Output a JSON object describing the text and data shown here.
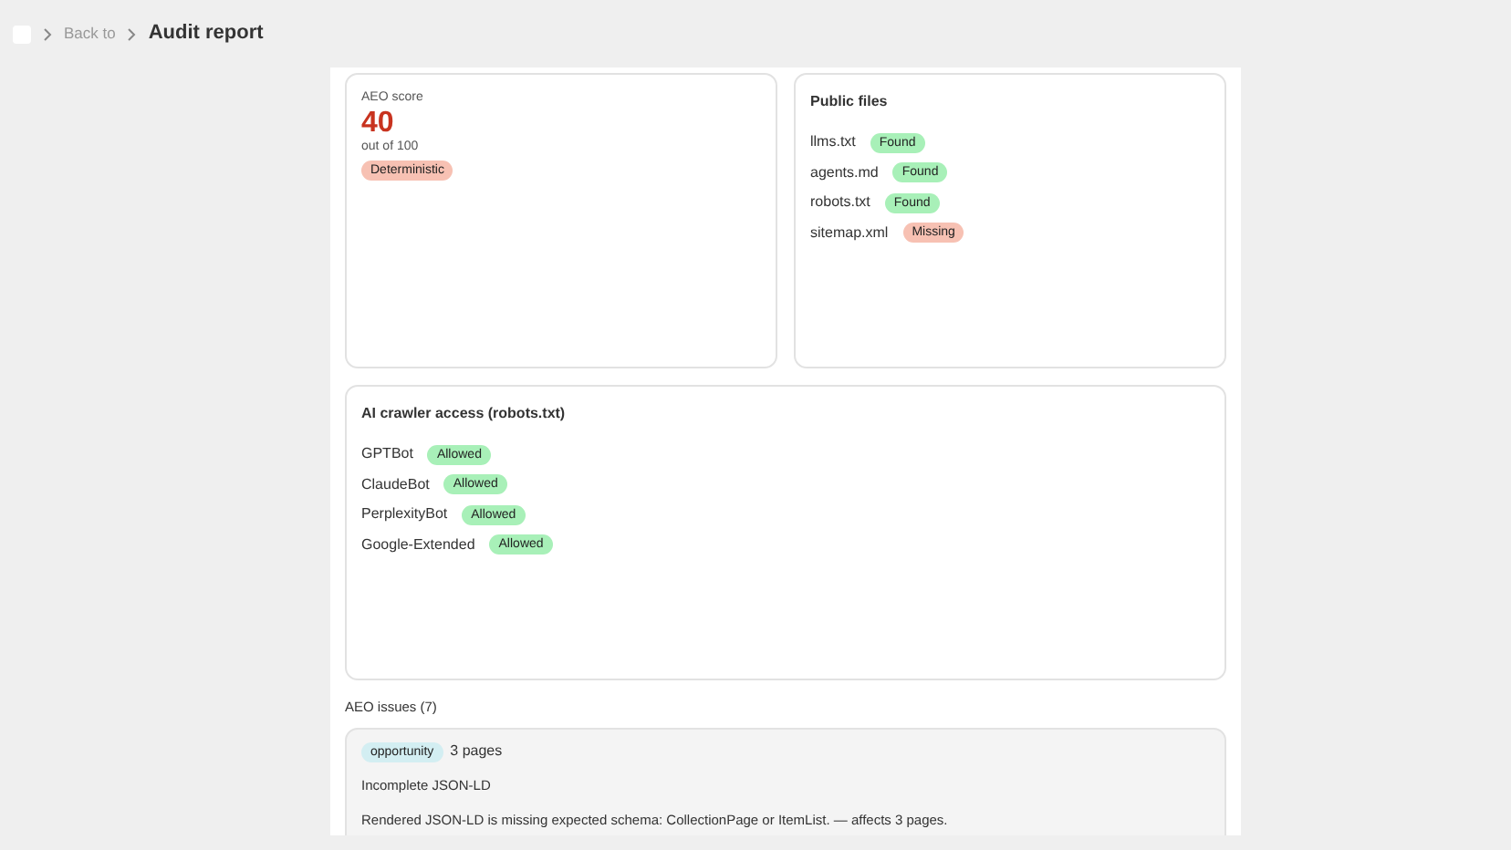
{
  "breadcrumb": {
    "back": "Back to",
    "current": "Audit report"
  },
  "score_card": {
    "label": "AEO score",
    "score": "40",
    "out_of": "out of 100",
    "badge": {
      "text": "Deterministic",
      "kind": "bad"
    }
  },
  "public_files": {
    "title": "Public files",
    "items": [
      {
        "name": "llms.txt",
        "status": "Found",
        "kind": "good"
      },
      {
        "name": "agents.md",
        "status": "Found",
        "kind": "good"
      },
      {
        "name": "robots.txt",
        "status": "Found",
        "kind": "good"
      },
      {
        "name": "sitemap.xml",
        "status": "Missing",
        "kind": "bad"
      }
    ]
  },
  "crawler_access": {
    "title": "AI crawler access (robots.txt)",
    "items": [
      {
        "name": "GPTBot",
        "status": "Allowed",
        "kind": "good"
      },
      {
        "name": "ClaudeBot",
        "status": "Allowed",
        "kind": "good"
      },
      {
        "name": "PerplexityBot",
        "status": "Allowed",
        "kind": "good"
      },
      {
        "name": "Google-Extended",
        "status": "Allowed",
        "kind": "good"
      }
    ]
  },
  "issues": {
    "heading": "AEO issues (7)",
    "items": [
      {
        "tag": "opportunity",
        "pages": "3 pages",
        "title": "Incomplete JSON-LD",
        "description": "Rendered JSON-LD is missing expected schema: CollectionPage or ItemList. — affects 3 pages."
      }
    ]
  }
}
